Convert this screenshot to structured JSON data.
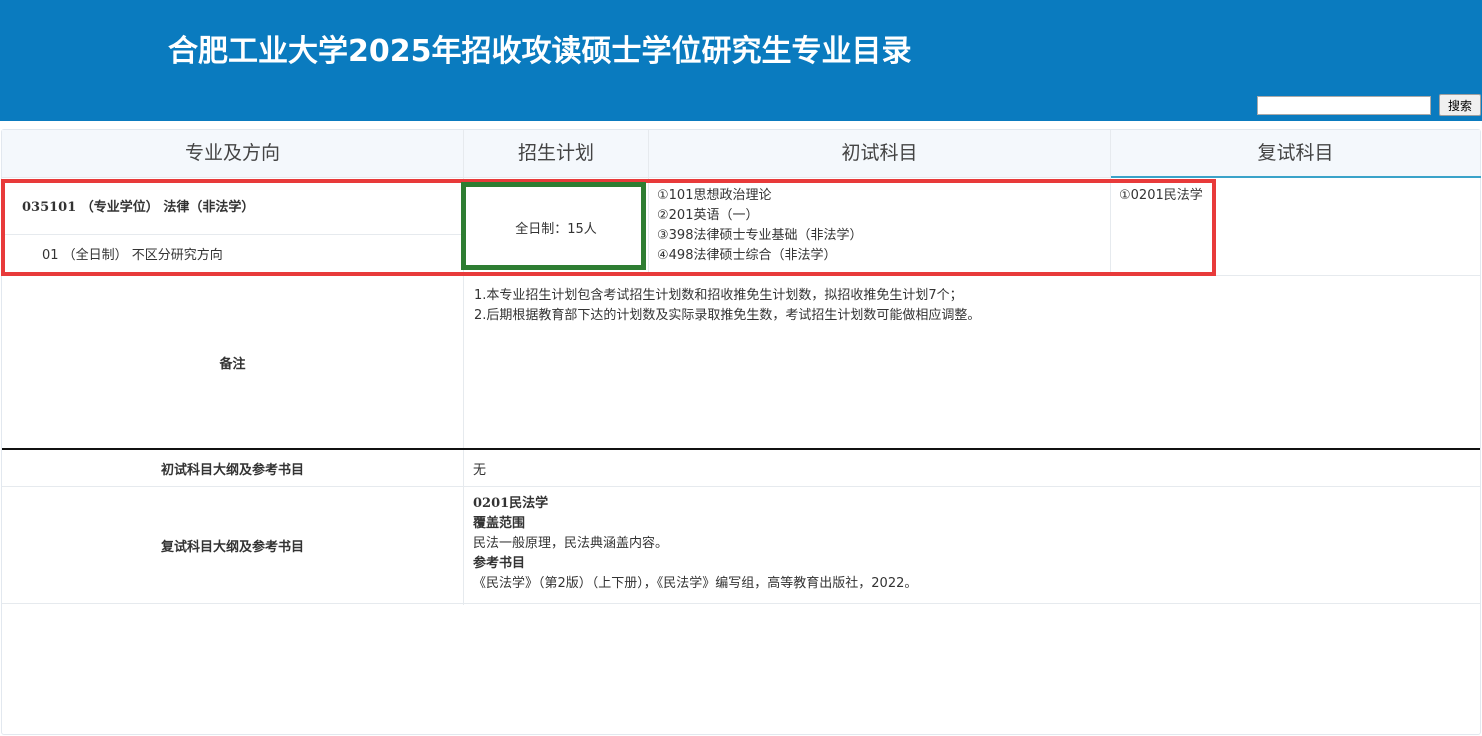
{
  "header": {
    "title": "合肥工业大学2025年招收攻读硕士学位研究生专业目录"
  },
  "search": {
    "input_value": "",
    "button_label": "搜索"
  },
  "table": {
    "columns": [
      "专业及方向",
      "招生计划",
      "初试科目",
      "复试科目"
    ],
    "major": {
      "title": "035101 （专业学位） 法律（非法学）",
      "direction": "01 （全日制） 不区分研究方向",
      "plan": "全日制：15人",
      "initial_subjects": [
        "①101思想政治理论",
        "②201英语（一）",
        "③398法律硕士专业基础（非法学）",
        "④498法律硕士综合（非法学）"
      ],
      "retest_subjects": [
        "①0201民法学"
      ]
    },
    "notes": {
      "label": "备注",
      "lines": [
        "1.本专业招生计划包含考试招生计划数和招收推免生计划数，拟招收推免生计划7个；",
        "2.后期根据教育部下达的计划数及实际录取推免生数，考试招生计划数可能做相应调整。"
      ]
    },
    "initial_outline": {
      "label": "初试科目大纲及参考书目",
      "value": "无"
    },
    "retest_outline": {
      "label": "复试科目大纲及参考书目",
      "subject": "0201民法学",
      "scope_heading": "覆盖范围",
      "scope_text": "民法一般原理，民法典涵盖内容。",
      "books_heading": "参考书目",
      "books_text": "《民法学》（第2版）（上下册），《民法学》编写组，高等教育出版社，2022。"
    }
  },
  "colors": {
    "header_bg": "#0a7bbf",
    "highlight_red": "#e83a3a",
    "highlight_green": "#2e7d32"
  }
}
